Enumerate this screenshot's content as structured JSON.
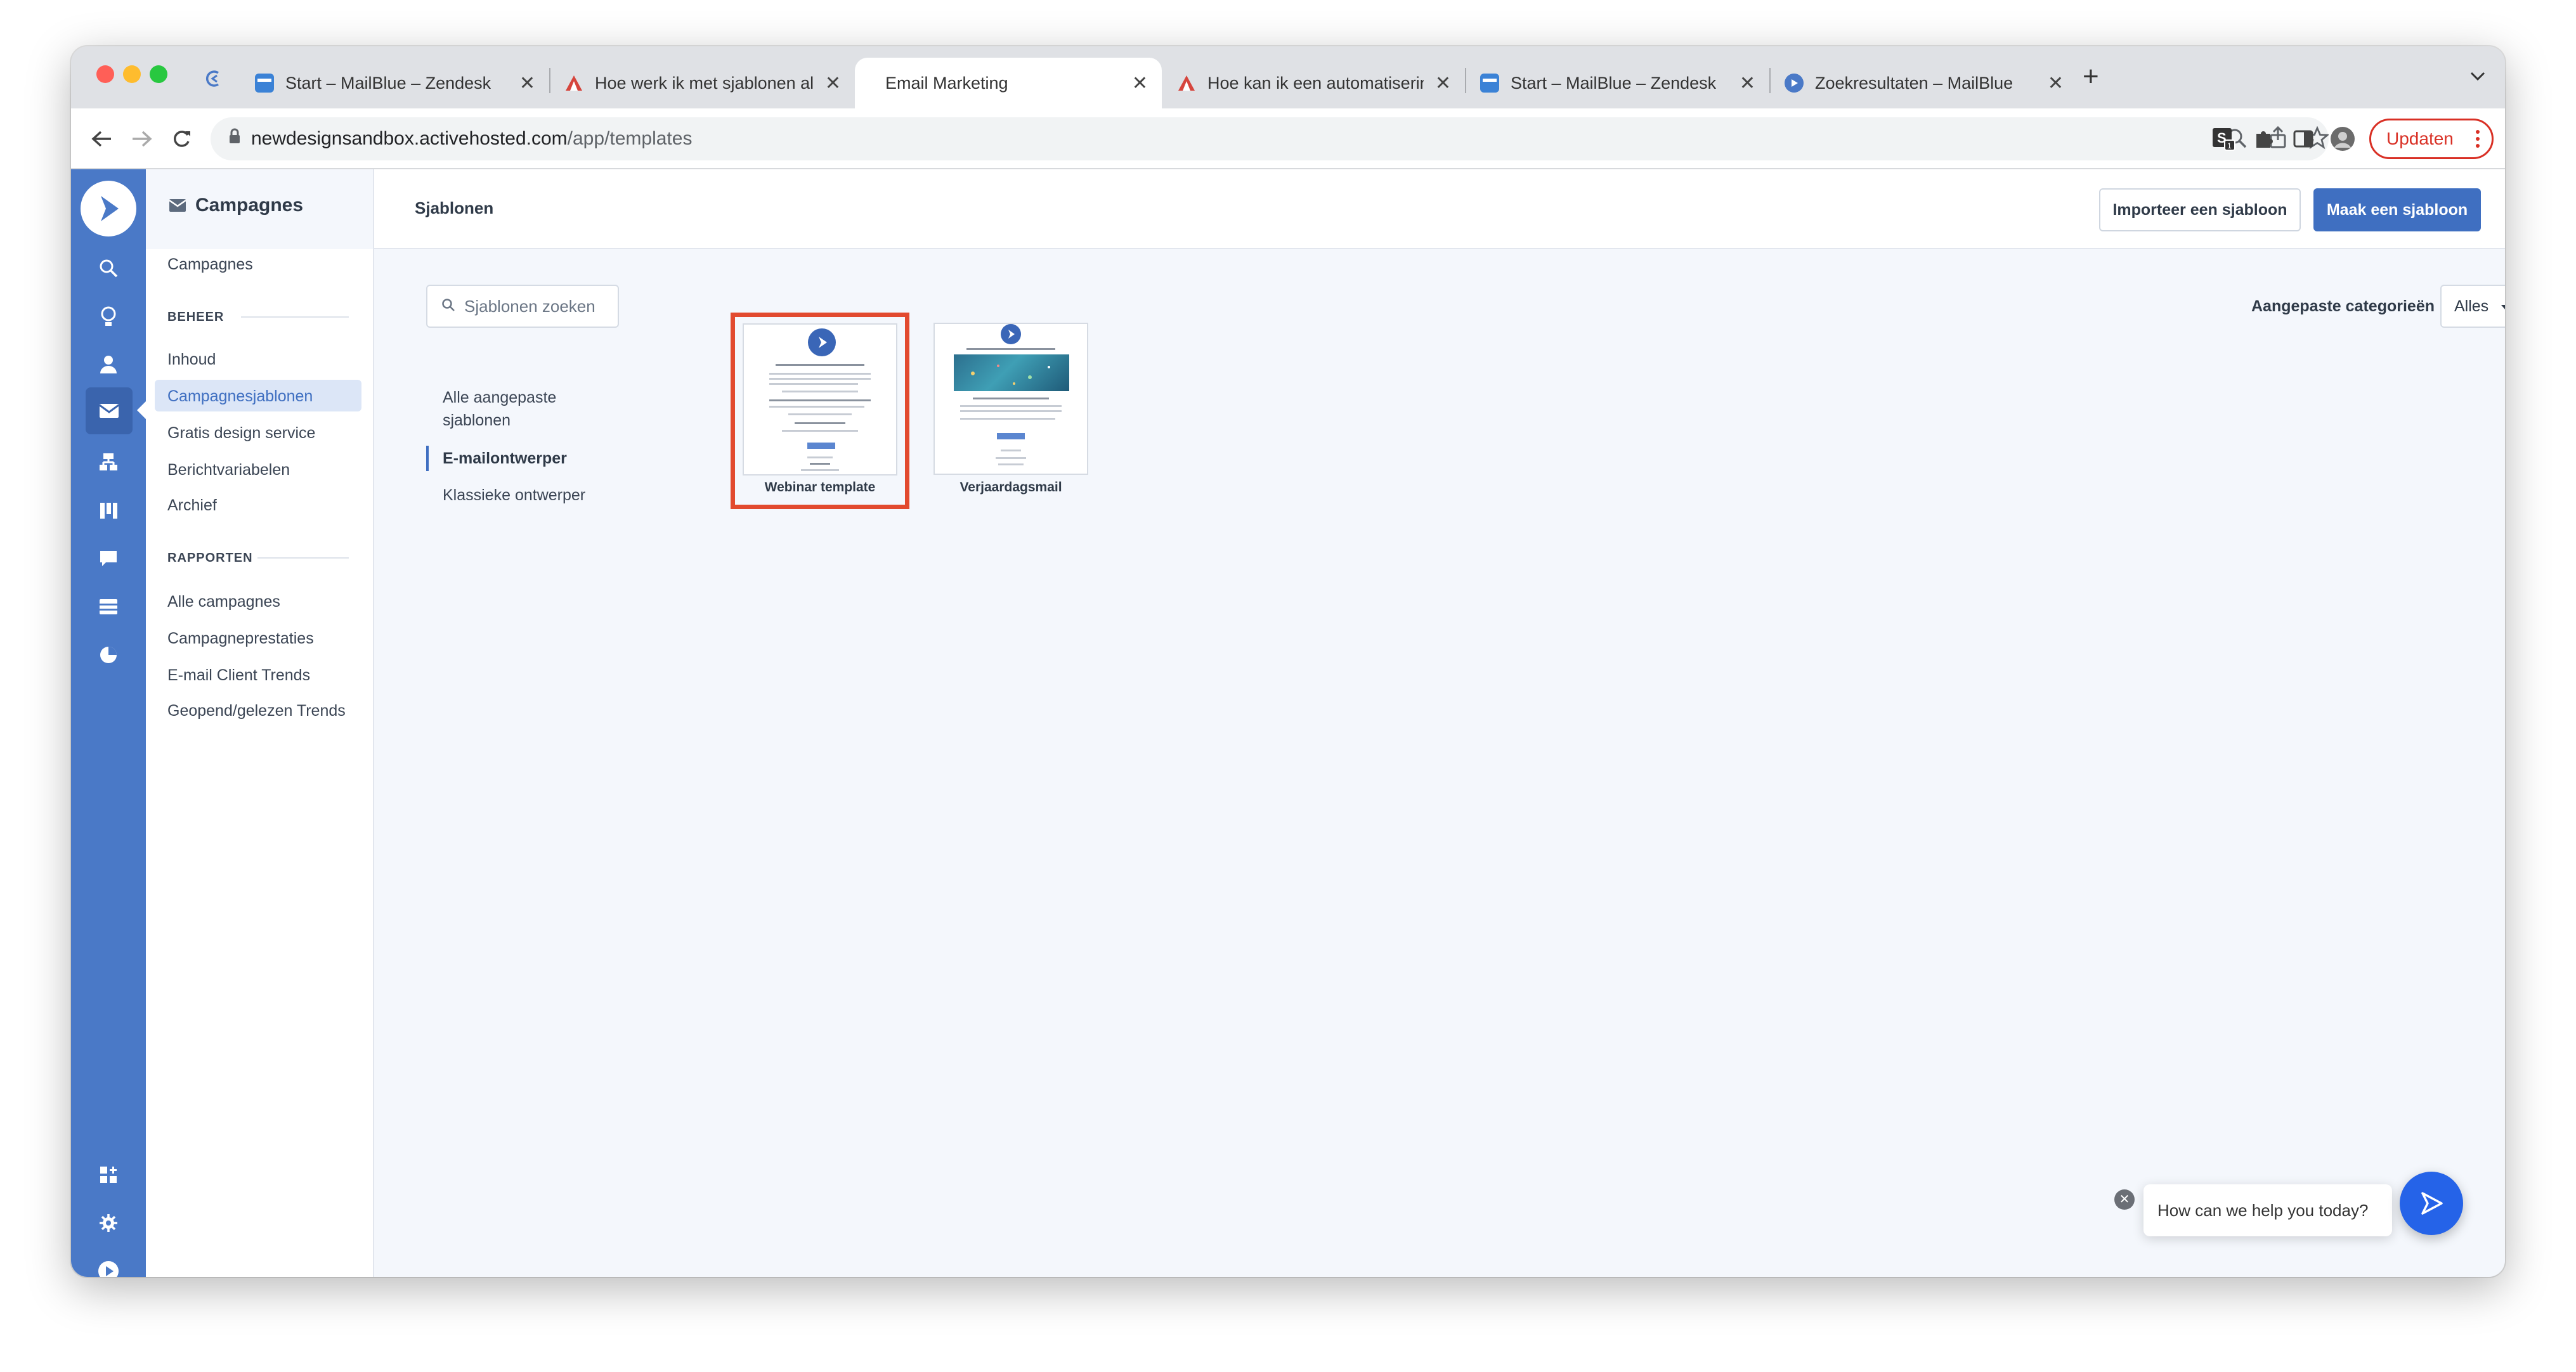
{
  "browser": {
    "tabs": [
      {
        "title": "Start – MailBlue – Zendesk",
        "favicon": "zendesk-icon",
        "active": false
      },
      {
        "title": "Hoe werk ik met sjablonen als",
        "favicon": "zendesk-guide-icon",
        "active": false
      },
      {
        "title": "Email Marketing",
        "favicon": "none",
        "active": true
      },
      {
        "title": "Hoe kan ik een automatisering",
        "favicon": "zendesk-guide-icon",
        "active": false
      },
      {
        "title": "Start – MailBlue – Zendesk",
        "favicon": "zendesk-icon",
        "active": false
      },
      {
        "title": "Zoekresultaten – MailBlue",
        "favicon": "mailblue-icon",
        "active": false
      }
    ],
    "url_host": "newdesignsandbox.activehosted.com",
    "url_path": "/app/templates",
    "update_label": "Updaten",
    "colors": {
      "update": "#d93025",
      "tabstrip": "#dfe1e5"
    }
  },
  "sidebar": {
    "section_title": "Campagnes",
    "top_link": "Campagnes",
    "beheer_heading": "BEHEER",
    "beheer_items": [
      {
        "label": "Inhoud",
        "active": false
      },
      {
        "label": "Campagnesjablonen",
        "active": true
      },
      {
        "label": "Gratis design service",
        "active": false
      },
      {
        "label": "Berichtvariabelen",
        "active": false
      },
      {
        "label": "Archief",
        "active": false
      }
    ],
    "rapporten_heading": "RAPPORTEN",
    "rapporten_items": [
      {
        "label": "Alle campagnes"
      },
      {
        "label": "Campagneprestaties"
      },
      {
        "label": "E-mail Client Trends"
      },
      {
        "label": "Geopend/gelezen Trends"
      }
    ]
  },
  "rail_icons": [
    "logo-icon",
    "search-icon",
    "lightbulb-icon",
    "contacts-icon",
    "campaigns-icon",
    "automations-icon",
    "deals-icon",
    "conversations-icon",
    "site-icon",
    "reports-icon",
    "apps-icon",
    "settings-icon",
    "account-icon"
  ],
  "page": {
    "title": "Sjablonen",
    "import_label": "Importeer een sjabloon",
    "create_label": "Maak een sjabloon",
    "search_placeholder": "Sjablonen zoeken",
    "category_filter_label": "Aangepaste categorieën",
    "category_filter_value": "Alles",
    "categories": [
      {
        "label": "Alle aangepaste sjablonen",
        "active": false
      },
      {
        "label": "E-mailontwerper",
        "active": true
      },
      {
        "label": "Klassieke ontwerper",
        "active": false
      }
    ],
    "templates": [
      {
        "name": "Webinar template",
        "highlighted": true
      },
      {
        "name": "Verjaardagsmail",
        "highlighted": false
      }
    ]
  },
  "chat": {
    "text": "How can we help you today?"
  },
  "colors": {
    "brand": "#4a79c7",
    "primary_button": "#3f6fc1",
    "highlight": "#e24a2f",
    "active_item_bg": "#dce6f7"
  }
}
